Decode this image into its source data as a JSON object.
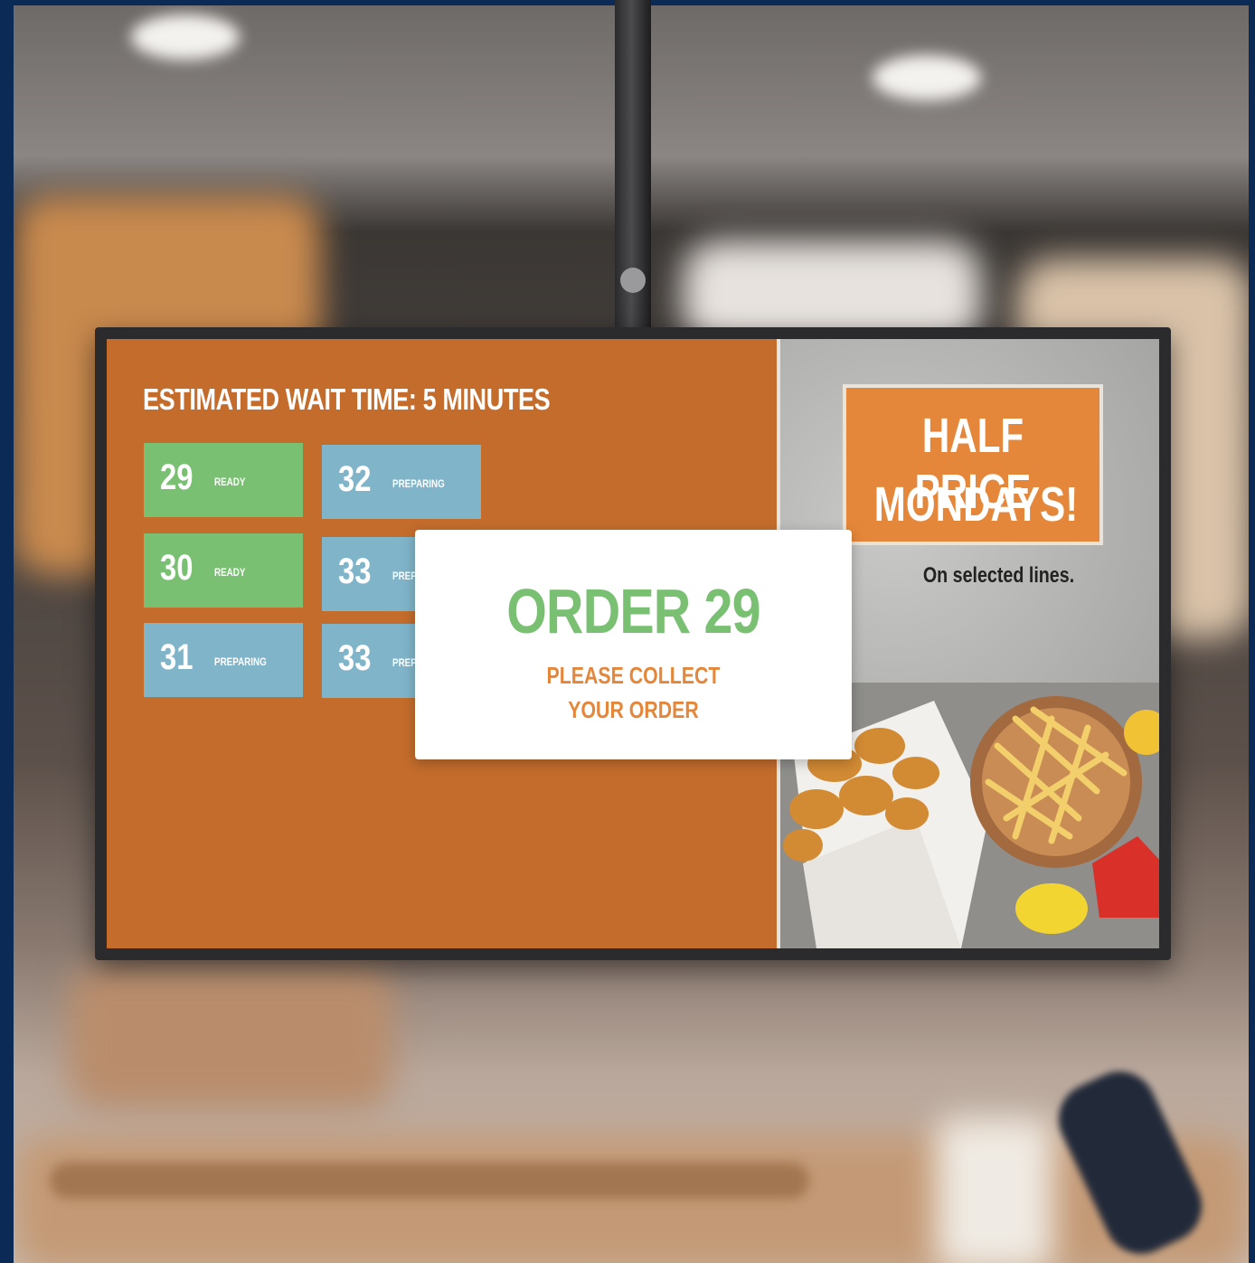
{
  "display": {
    "wait_time_heading": "ESTIMATED WAIT TIME: 5 MINUTES",
    "orders": [
      {
        "number": "29",
        "status": "READY"
      },
      {
        "number": "32",
        "status": "PREPARING"
      },
      {
        "number": "30",
        "status": "READY"
      },
      {
        "number": "33",
        "status": "PREPARING"
      },
      {
        "number": "31",
        "status": "PREPARING"
      },
      {
        "number": "33",
        "status": "PREPARING"
      }
    ],
    "popup": {
      "title": "ORDER 29",
      "line1": "PLEASE COLLECT",
      "line2": "YOUR ORDER"
    },
    "promo": {
      "line1": "HALF PRICE",
      "line2": "MONDAYS!",
      "note": "On selected lines."
    }
  },
  "colors": {
    "screen_orange": "#c36c2c",
    "ready_green": "#79c072",
    "preparing_blue": "#7fb4c9",
    "promo_orange": "#e4873a"
  }
}
